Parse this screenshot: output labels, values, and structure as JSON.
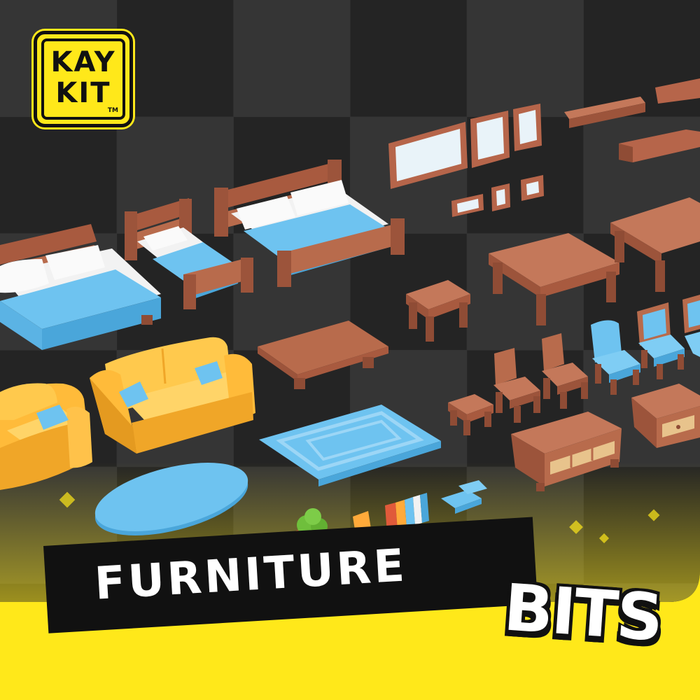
{
  "logo": {
    "line1": "KAY",
    "line2": "KIT",
    "tm": "TM"
  },
  "banner": {
    "title": "FURNITURE",
    "subtitle": "BITS"
  },
  "colors": {
    "background_yellow": "#ffe81a",
    "wood": "#b86b4c",
    "fabric_blue": "#6ec3f0",
    "sofa_yellow": "#ffbb3a",
    "pillow_white": "#f2f2f2"
  },
  "items": [
    "bed-double",
    "bed-single",
    "bed-double-2",
    "picture-frames",
    "shelves",
    "tables",
    "stool",
    "chairs",
    "couch",
    "armchair",
    "coffee-table",
    "rug-rectangle",
    "rug-oval",
    "cabinet",
    "nightstand",
    "books",
    "potted-cactus",
    "pillows"
  ]
}
